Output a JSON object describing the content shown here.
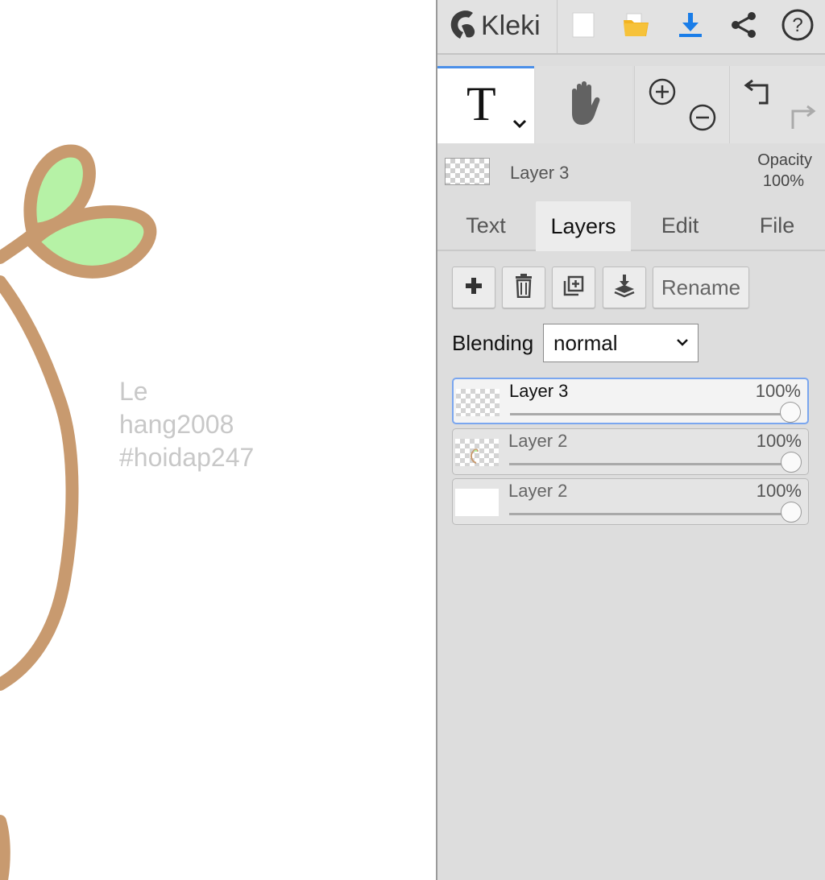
{
  "app": {
    "name": "Kleki"
  },
  "canvas": {
    "text_lines": [
      "Le",
      "hang2008",
      "#hoidap247"
    ],
    "colors": {
      "stroke": "#c89a6f",
      "leaf": "#b6f2a6",
      "text": "#c8c8c8"
    }
  },
  "topbar": {
    "icons": [
      "kleki-logo-icon",
      "new-file-icon",
      "open-folder-icon",
      "download-icon",
      "share-icon",
      "help-icon"
    ]
  },
  "tools": {
    "active": "text",
    "icons": [
      "text-tool-icon",
      "hand-tool-icon",
      "zoom-in-icon",
      "zoom-out-icon",
      "undo-icon",
      "redo-icon"
    ],
    "text_tool_glyph": "T"
  },
  "layer_info": {
    "name": "Layer 3",
    "opacity_label": "Opacity",
    "opacity_value": "100%"
  },
  "tabs": [
    {
      "label": "Text",
      "active": false
    },
    {
      "label": "Layers",
      "active": true
    },
    {
      "label": "Edit",
      "active": false
    },
    {
      "label": "File",
      "active": false
    }
  ],
  "layers_panel": {
    "rename_label": "Rename",
    "blending_label": "Blending",
    "blending_value": "normal",
    "layers": [
      {
        "name": "Layer 3",
        "opacity": "100%",
        "opacity_fraction": 1.0,
        "selected": true
      },
      {
        "name": "Layer 2",
        "opacity": "100%",
        "opacity_fraction": 1.0,
        "selected": false
      },
      {
        "name": "Layer 2",
        "opacity": "100%",
        "opacity_fraction": 1.0,
        "selected": false
      }
    ]
  },
  "accent_color": "#4b8fe8"
}
